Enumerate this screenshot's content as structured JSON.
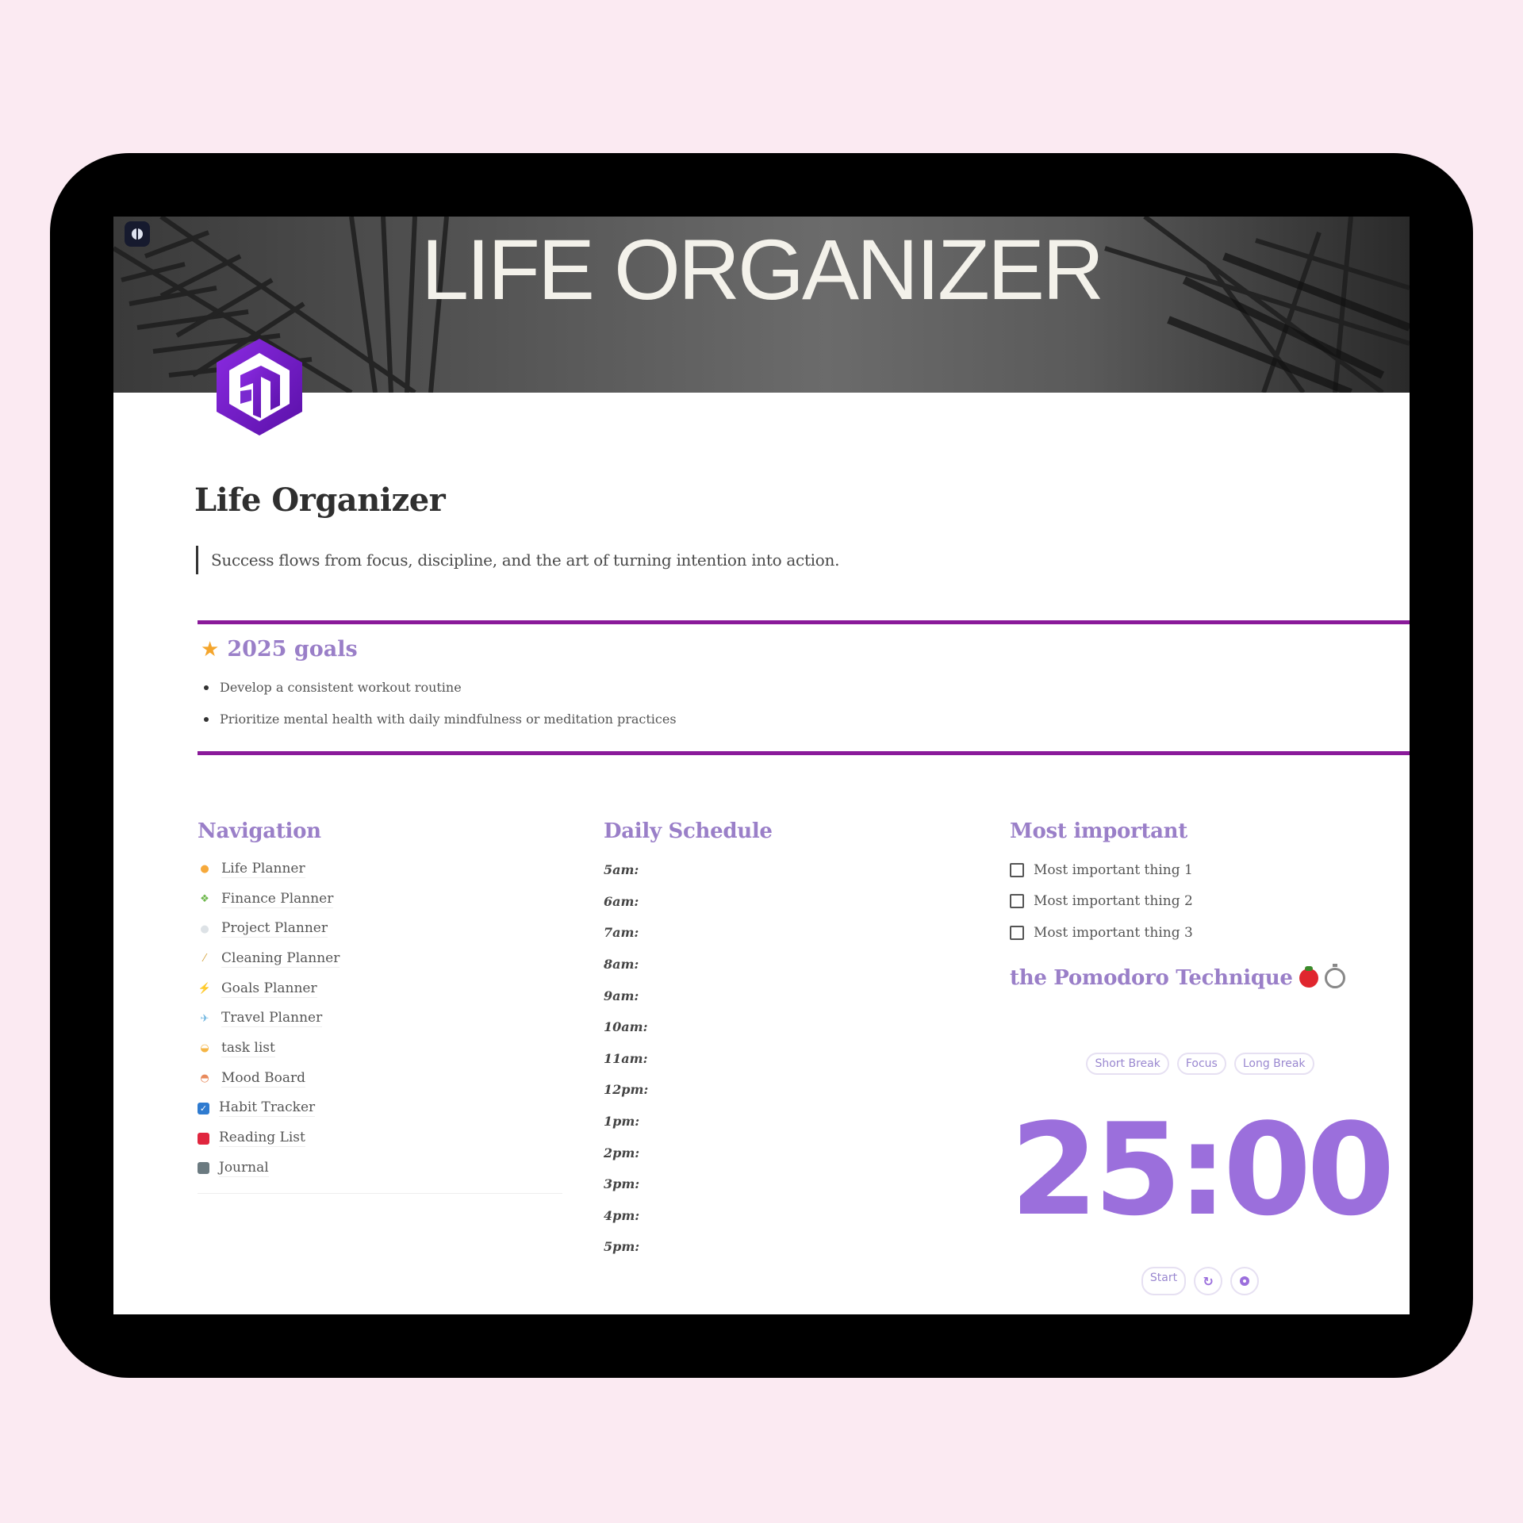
{
  "cover": {
    "title": "LIFE ORGANIZER"
  },
  "page": {
    "title": "Life Organizer",
    "quote": "Success flows from focus, discipline, and the art of turning intention into action."
  },
  "goals": {
    "icon": "star-icon",
    "heading": "2025 goals",
    "items": [
      "Develop a consistent workout routine",
      "Prioritize mental health with daily mindfulness or meditation practices"
    ]
  },
  "navigation": {
    "heading": "Navigation",
    "items": [
      {
        "label": "Life Planner",
        "icon": "sun-icon"
      },
      {
        "label": "Finance Planner",
        "icon": "money-icon"
      },
      {
        "label": "Project Planner",
        "icon": "cloud-icon"
      },
      {
        "label": "Cleaning Planner",
        "icon": "broom-icon"
      },
      {
        "label": "Goals Planner",
        "icon": "lightning-icon"
      },
      {
        "label": "Travel Planner",
        "icon": "airplane-icon"
      },
      {
        "label": "task list",
        "icon": "sunrise-icon"
      },
      {
        "label": "Mood Board",
        "icon": "bowl-icon"
      },
      {
        "label": "Habit Tracker",
        "icon": "checkbox-icon"
      },
      {
        "label": "Reading List",
        "icon": "book-icon"
      },
      {
        "label": "Journal",
        "icon": "notebook-icon"
      }
    ]
  },
  "schedule": {
    "heading": "Daily Schedule",
    "slots": [
      "5am:",
      "6am:",
      "7am:",
      "8am:",
      "9am:",
      "10am:",
      "11am:",
      "12pm:",
      "1pm:",
      "2pm:",
      "3pm:",
      "4pm:",
      "5pm:"
    ]
  },
  "important": {
    "heading": "Most important",
    "items": [
      "Most important thing 1",
      "Most important thing 2",
      "Most important thing 3"
    ]
  },
  "pomodoro": {
    "heading": "the Pomodoro Technique",
    "modes": [
      "Short Break",
      "Focus",
      "Long Break"
    ],
    "timer": "25:00",
    "start_label": "Start"
  },
  "colors": {
    "accent": "#9a7fc8",
    "divider": "#8a1a9a",
    "timer": "#9b6fdc",
    "background": "#fbeaf2"
  }
}
